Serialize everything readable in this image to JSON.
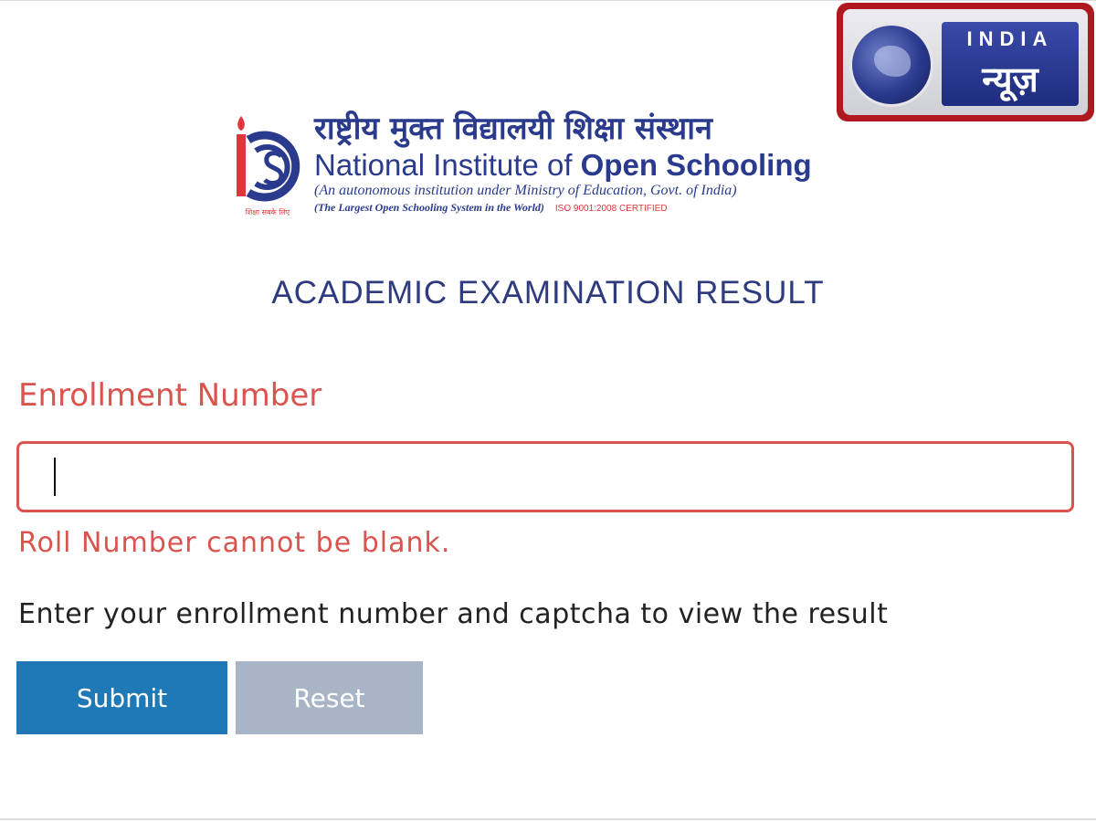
{
  "watermark": {
    "line1": "INDIA",
    "line2": "न्यूज़",
    "icon": "globe-icon"
  },
  "org": {
    "name_hindi": "राष्ट्रीय मुक्त विद्यालयी शिक्षा संस्थान",
    "name_english_regular": "National Institute of ",
    "name_english_bold": "Open Schooling",
    "tagline": "(An autonomous institution under Ministry of Education, Govt. of India)",
    "tagline2": "(The Largest Open Schooling System in the World)",
    "certification": "ISO 9001:2008 CERTIFIED",
    "emblem_caption": "शिक्षा सबके लिए",
    "emblem_icon": "nios-emblem-icon"
  },
  "page": {
    "title": "ACADEMIC EXAMINATION RESULT"
  },
  "form": {
    "enrollment_label": "Enrollment Number",
    "enrollment_value": "",
    "error": "Roll Number cannot be blank.",
    "instruction": "Enter your enrollment number and captcha to view the result",
    "submit_label": "Submit",
    "reset_label": "Reset"
  },
  "colors": {
    "brand_blue": "#2a3a8c",
    "error_red": "#d9534f",
    "submit_blue": "#1f79b6",
    "reset_gray": "#a8b5c6",
    "watermark_red": "#b01820"
  }
}
